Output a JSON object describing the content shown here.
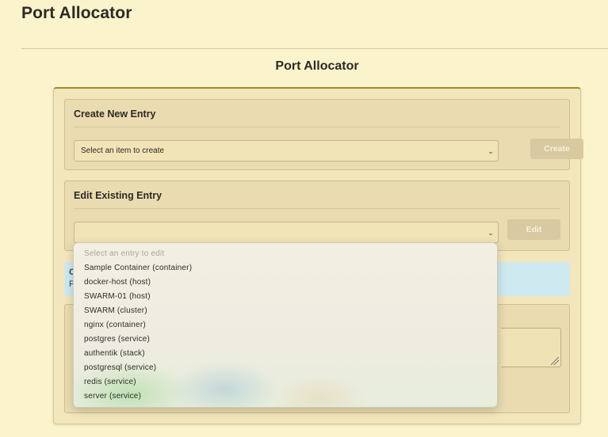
{
  "app": {
    "title": "Port Allocator"
  },
  "main": {
    "heading": "Port Allocator",
    "create_panel": {
      "title": "Create New Entry",
      "select_value": "Select an item to create",
      "button_label": "Create"
    },
    "edit_panel": {
      "title": "Edit Existing Entry",
      "select_value": "",
      "button_label": "Edit"
    },
    "alert": {
      "line1": "C",
      "line2": "F"
    },
    "dropdown": {
      "options": [
        "Select an entry to edit",
        "Sample Container (container)",
        "docker-host (host)",
        "SWARM-01 (host)",
        "SWARM (cluster)",
        "nginx (container)",
        "postgres (service)",
        "authentik (stack)",
        "postgresql (service)",
        "redis (service)",
        "server (service)"
      ]
    }
  },
  "colors": {
    "background": "#fbf3cb",
    "panel": "#eadcb0",
    "accent_border": "#9c8f2b",
    "info_alert": "#cfe9f1",
    "button_disabled": "#d8c9a0"
  },
  "icons": {
    "select_chevron": "chevron-down-icon",
    "resize_handle": "resize-handle-icon"
  }
}
